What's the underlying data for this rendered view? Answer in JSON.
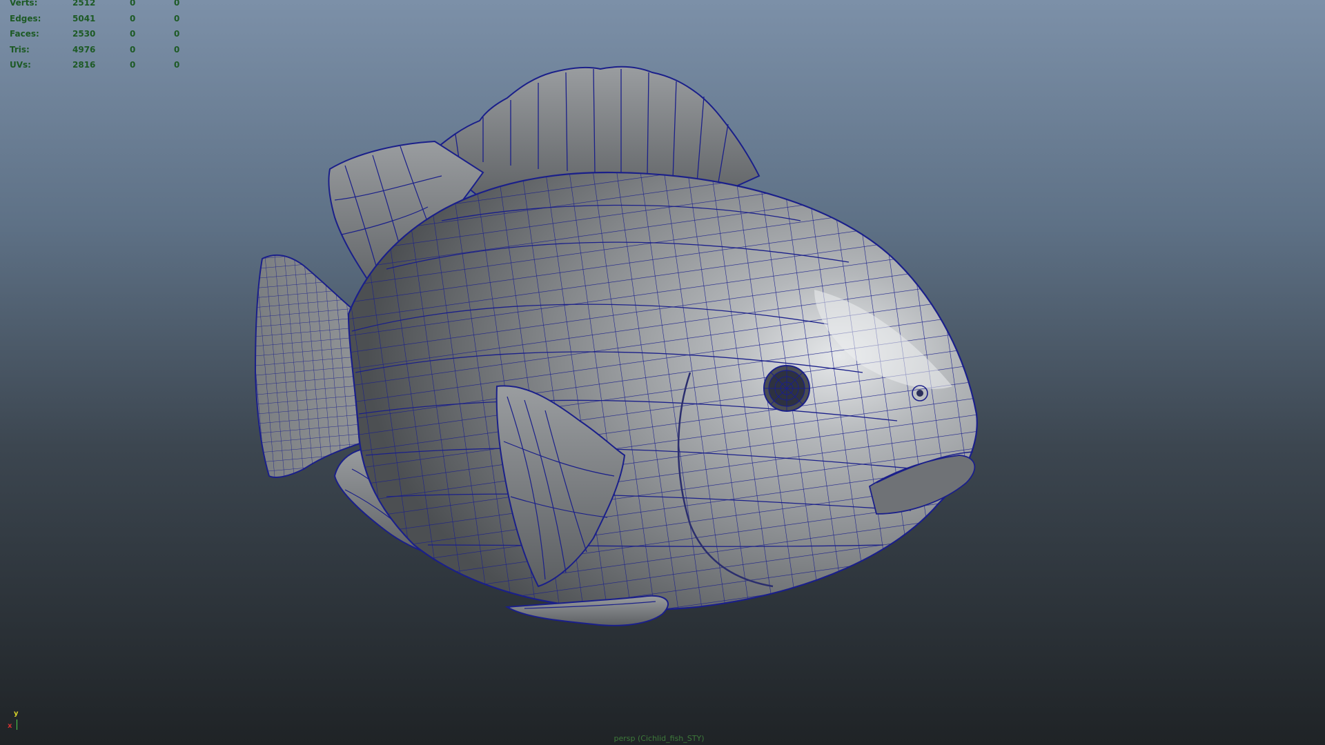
{
  "hud": {
    "rows": [
      {
        "label": "Verts:",
        "c1": "2512",
        "c2": "0",
        "c3": "0"
      },
      {
        "label": "Edges:",
        "c1": "5041",
        "c2": "0",
        "c3": "0"
      },
      {
        "label": "Faces:",
        "c1": "2530",
        "c2": "0",
        "c3": "0"
      },
      {
        "label": "Tris:",
        "c1": "4976",
        "c2": "0",
        "c3": "0"
      },
      {
        "label": "UVs:",
        "c1": "2816",
        "c2": "0",
        "c3": "0"
      }
    ]
  },
  "axis": {
    "y": "y",
    "x": "x"
  },
  "camera_label": "persp (Cichlid_fish_STY)",
  "colors": {
    "hud_text": "#1d5a25",
    "wireframe": "#1a1f8a",
    "mesh": "#8e9194",
    "bg_top": "#7c90a8",
    "bg_bottom": "#1f2326"
  }
}
